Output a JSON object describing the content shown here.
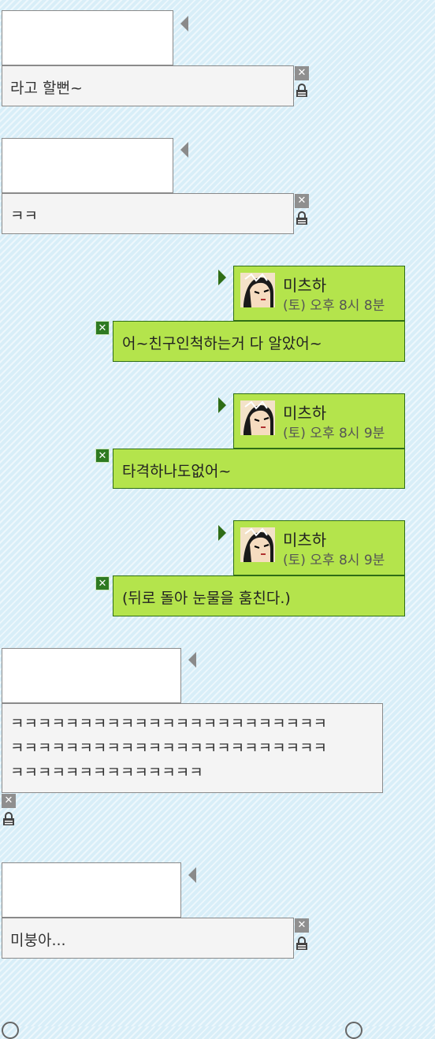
{
  "messages": [
    {
      "side": "left",
      "text": "라고 할뻔~"
    },
    {
      "side": "left",
      "text": "ㅋㅋ"
    },
    {
      "side": "right",
      "name": "미츠하",
      "time": "(토) 오후 8시 8분",
      "text": "어~친구인척하는거 다 알았어~"
    },
    {
      "side": "right",
      "name": "미츠하",
      "time": "(토) 오후 8시 9분",
      "text": "타격하나도없어~"
    },
    {
      "side": "right",
      "name": "미츠하",
      "time": "(토) 오후 8시 9분",
      "text": "(뒤로 돌아 눈물을 훔친다.)"
    },
    {
      "side": "left",
      "lines": [
        "ㅋㅋㅋㅋㅋㅋㅋㅋㅋㅋㅋㅋㅋㅋㅋㅋㅋㅋㅋㅋㅋㅋㅋ",
        "ㅋㅋㅋㅋㅋㅋㅋㅋㅋㅋㅋㅋㅋㅋㅋㅋㅋㅋㅋㅋㅋㅋㅋ",
        "ㅋㅋㅋㅋㅋㅋㅋㅋㅋㅋㅋㅋㅋㅋ"
      ]
    },
    {
      "side": "left",
      "text": "미붕아..."
    }
  ],
  "icons": {
    "delete": "close-icon",
    "lock": "lock-icon",
    "avatar": "avatar-image",
    "pointer": "speech-arrow-icon"
  },
  "colors": {
    "background": "#d8eef8",
    "my_bubble": "#b4e44c",
    "my_border": "#2f6d16",
    "other_bubble": "#f4f4f4",
    "other_border": "#8a8a8a"
  }
}
